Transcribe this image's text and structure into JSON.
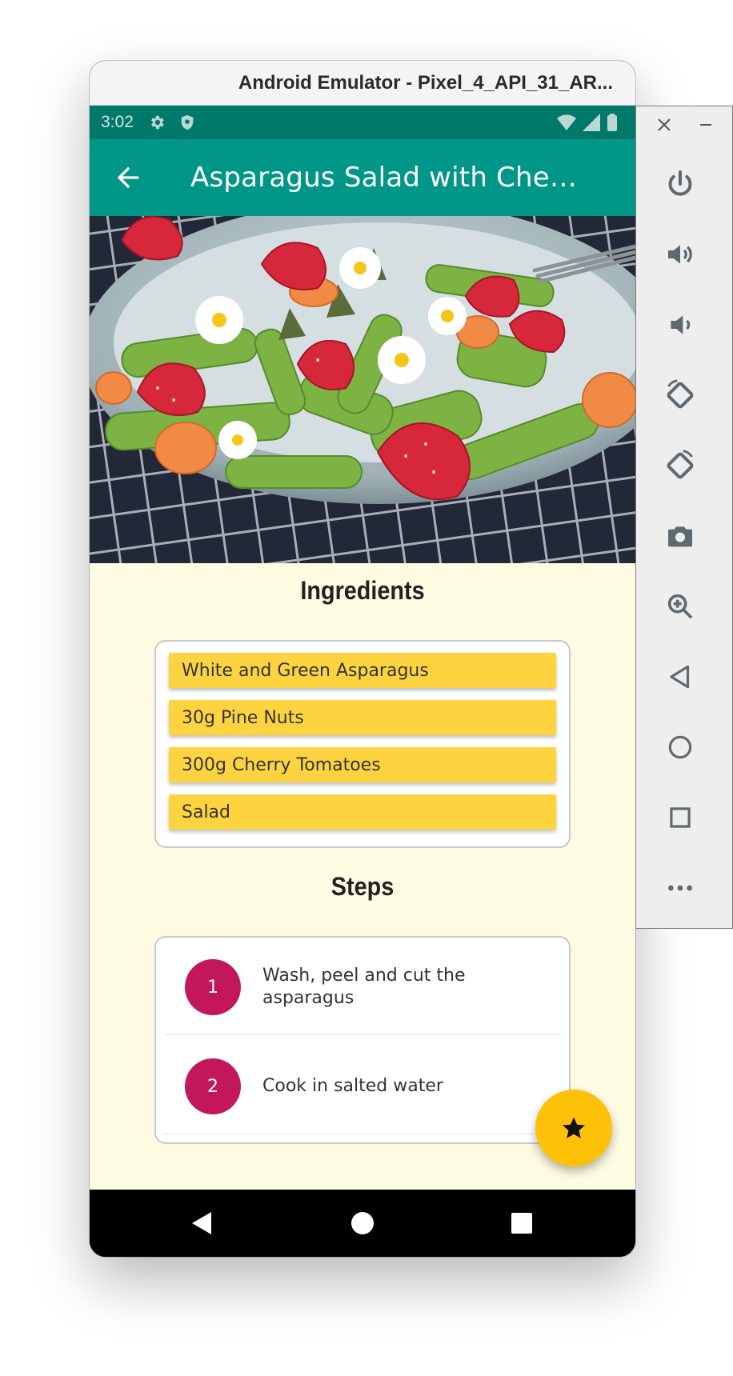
{
  "window": {
    "title": "Android Emulator - Pixel_4_API_31_AR..."
  },
  "status_bar": {
    "time": "3:02"
  },
  "app_bar": {
    "title": "Asparagus Salad with Cherry ...",
    "back_icon": "arrow-back-icon"
  },
  "colors": {
    "primary": "#009688",
    "primary_dark": "#00796b",
    "accent": "#fdc107",
    "chip": "#fdd440",
    "step_circle": "#c2185b",
    "background": "#fefbe3"
  },
  "ingredients": {
    "title": "Ingredients",
    "items": [
      "White and Green Asparagus",
      "30g Pine Nuts",
      "300g Cherry Tomatoes",
      "Salad"
    ]
  },
  "steps": {
    "title": "Steps",
    "items": [
      {
        "number": "1",
        "text": "Wash, peel and cut the asparagus"
      },
      {
        "number": "2",
        "text": "Cook in salted water"
      }
    ]
  },
  "fab": {
    "icon": "star-icon"
  },
  "toolbar": {
    "items": [
      "power-icon",
      "volume-up-icon",
      "volume-down-icon",
      "rotate-left-icon",
      "rotate-right-icon",
      "camera-icon",
      "zoom-icon",
      "back-icon",
      "home-icon",
      "overview-icon",
      "more-icon"
    ]
  }
}
